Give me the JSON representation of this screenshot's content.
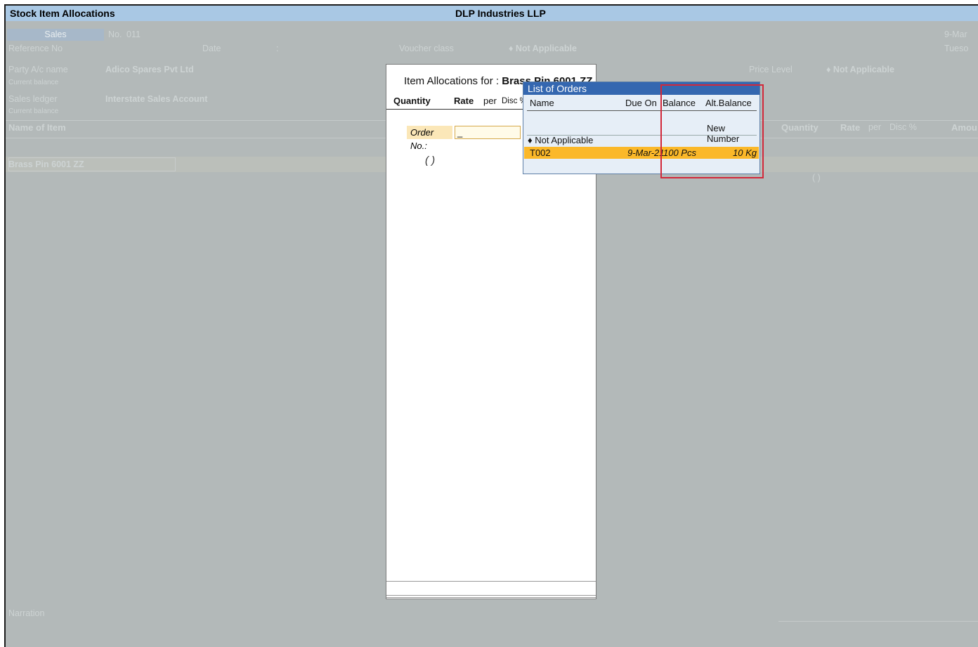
{
  "window": {
    "title": "Stock Item Allocations",
    "company": "DLP Industries LLP"
  },
  "voucher": {
    "type": "Sales",
    "no_label": "No.",
    "no_value": "011",
    "date_right": "9-Mar",
    "day_right": "Tueso",
    "reference_label": "Reference No",
    "date_label": "Date",
    "date_sep": ":",
    "voucher_class_label": "Voucher class",
    "voucher_class_value": "♦ Not Applicable",
    "party_label": "Party A/c name",
    "party_value": "Adico Spares Pvt Ltd",
    "current_balance_label": "Current balance",
    "price_level_label": "Price Level",
    "price_level_value": "♦ Not Applicable",
    "sales_ledger_label": "Sales ledger",
    "sales_ledger_value": "Interstate Sales Account",
    "current_balance_label2": "Current balance",
    "columns": {
      "name_of_item": "Name of Item",
      "quantity": "Quantity",
      "rate": "Rate",
      "per": "per",
      "disc": "Disc %",
      "amount": "Amou"
    },
    "item_name": "Brass Pin 6001 ZZ",
    "item_paren": "( )",
    "narration_label": "Narration"
  },
  "allocation_panel": {
    "title_prefix": "Item Allocations for :",
    "title_item": "Brass Pin 6001 ZZ",
    "col_quantity": "Quantity",
    "col_rate": "Rate",
    "col_per": "per",
    "col_disc": "Disc %",
    "order_no_label": "Order No.:",
    "order_no_value": "_",
    "paren": "( )"
  },
  "orders_list": {
    "title": "List of Orders",
    "headers": {
      "name": "Name",
      "due_on": "Due On",
      "balance": "Balance",
      "alt_balance": "Alt.Balance"
    },
    "new_number": "New Number",
    "not_applicable": "♦ Not Applicable",
    "selected_row": {
      "name": "T002",
      "due_on": "9-Mar-21",
      "balance": "100 Pcs",
      "alt_balance": "10 Kg"
    }
  },
  "colors": {
    "title_bar": "#a9c8e4",
    "list_title": "#3467b0",
    "selected_row": "#fbb829",
    "highlight_box": "#d2283a"
  }
}
